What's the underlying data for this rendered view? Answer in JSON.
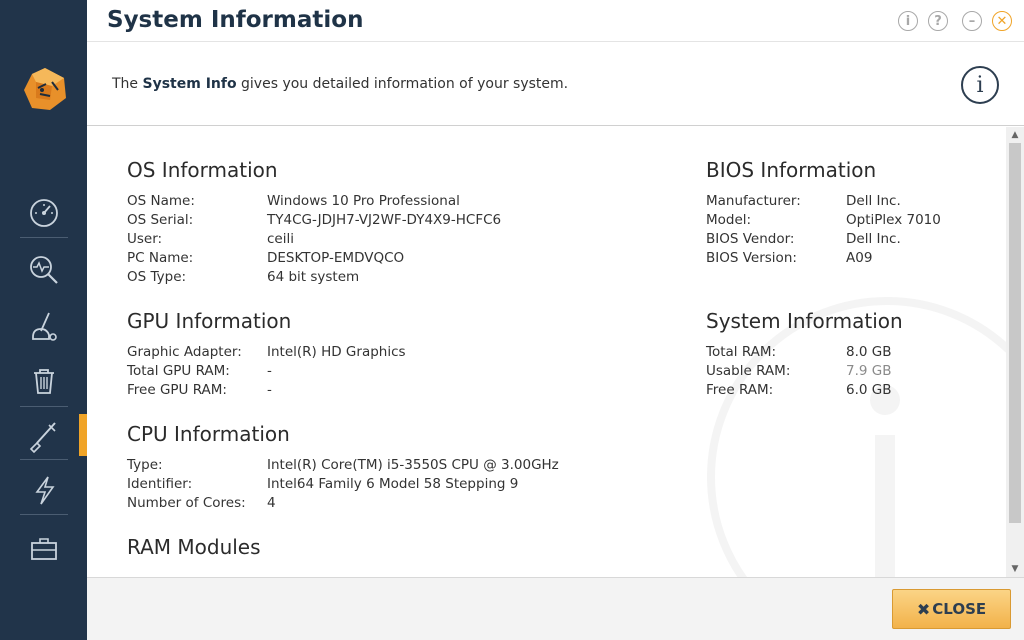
{
  "header": {
    "title": "System Information"
  },
  "window_controls": {
    "info": "i",
    "help": "?",
    "minimize": "–",
    "close": "✕"
  },
  "description": {
    "prefix": "The ",
    "bold": "System Info",
    "suffix": " gives you detailed information of your system."
  },
  "info_icon": "i",
  "sidebar": {
    "items": [
      {
        "icon": "speedometer-icon"
      },
      {
        "icon": "scan-magnifier-icon"
      },
      {
        "icon": "vacuum-icon"
      },
      {
        "icon": "trash-icon"
      },
      {
        "icon": "tools-icon",
        "active": true
      },
      {
        "icon": "lightning-icon"
      },
      {
        "icon": "toolbox-icon"
      }
    ]
  },
  "os": {
    "heading": "OS Information",
    "rows": [
      {
        "k": "OS Name:",
        "v": "Windows 10 Pro Professional"
      },
      {
        "k": "OS Serial:",
        "v": "TY4CG-JDJH7-VJ2WF-DY4X9-HCFC6"
      },
      {
        "k": "User:",
        "v": "ceili"
      },
      {
        "k": "PC Name:",
        "v": "DESKTOP-EMDVQCO"
      },
      {
        "k": "OS Type:",
        "v": "64 bit system"
      }
    ]
  },
  "gpu": {
    "heading": "GPU Information",
    "rows": [
      {
        "k": "Graphic Adapter:",
        "v": "Intel(R) HD Graphics"
      },
      {
        "k": "Total GPU RAM:",
        "v": "-"
      },
      {
        "k": "Free GPU RAM:",
        "v": "-"
      }
    ]
  },
  "cpu": {
    "heading": "CPU Information",
    "rows": [
      {
        "k": "Type:",
        "v": "Intel(R) Core(TM) i5-3550S CPU @ 3.00GHz"
      },
      {
        "k": "Identifier:",
        "v": "Intel64 Family 6 Model 58 Stepping 9"
      },
      {
        "k": "Number of Cores:",
        "v": "4"
      }
    ]
  },
  "ram_modules": {
    "heading": "RAM Modules"
  },
  "bios": {
    "heading": "BIOS Information",
    "rows": [
      {
        "k": "Manufacturer:",
        "v": "Dell Inc."
      },
      {
        "k": "Model:",
        "v": "OptiPlex 7010"
      },
      {
        "k": "BIOS Vendor:",
        "v": "Dell Inc."
      },
      {
        "k": "BIOS Version:",
        "v": "A09"
      }
    ]
  },
  "system": {
    "heading": "System Information",
    "rows": [
      {
        "k": "Total RAM:",
        "v": "8.0 GB"
      },
      {
        "k": "Usable RAM:",
        "v": "7.9 GB"
      },
      {
        "k": "Free RAM:",
        "v": "6.0 GB"
      }
    ]
  },
  "footer": {
    "close_icon": "✖",
    "close_label": "CLOSE"
  },
  "colors": {
    "sidebar": "#21344a",
    "accent": "#f0a428",
    "title": "#1f3347"
  }
}
